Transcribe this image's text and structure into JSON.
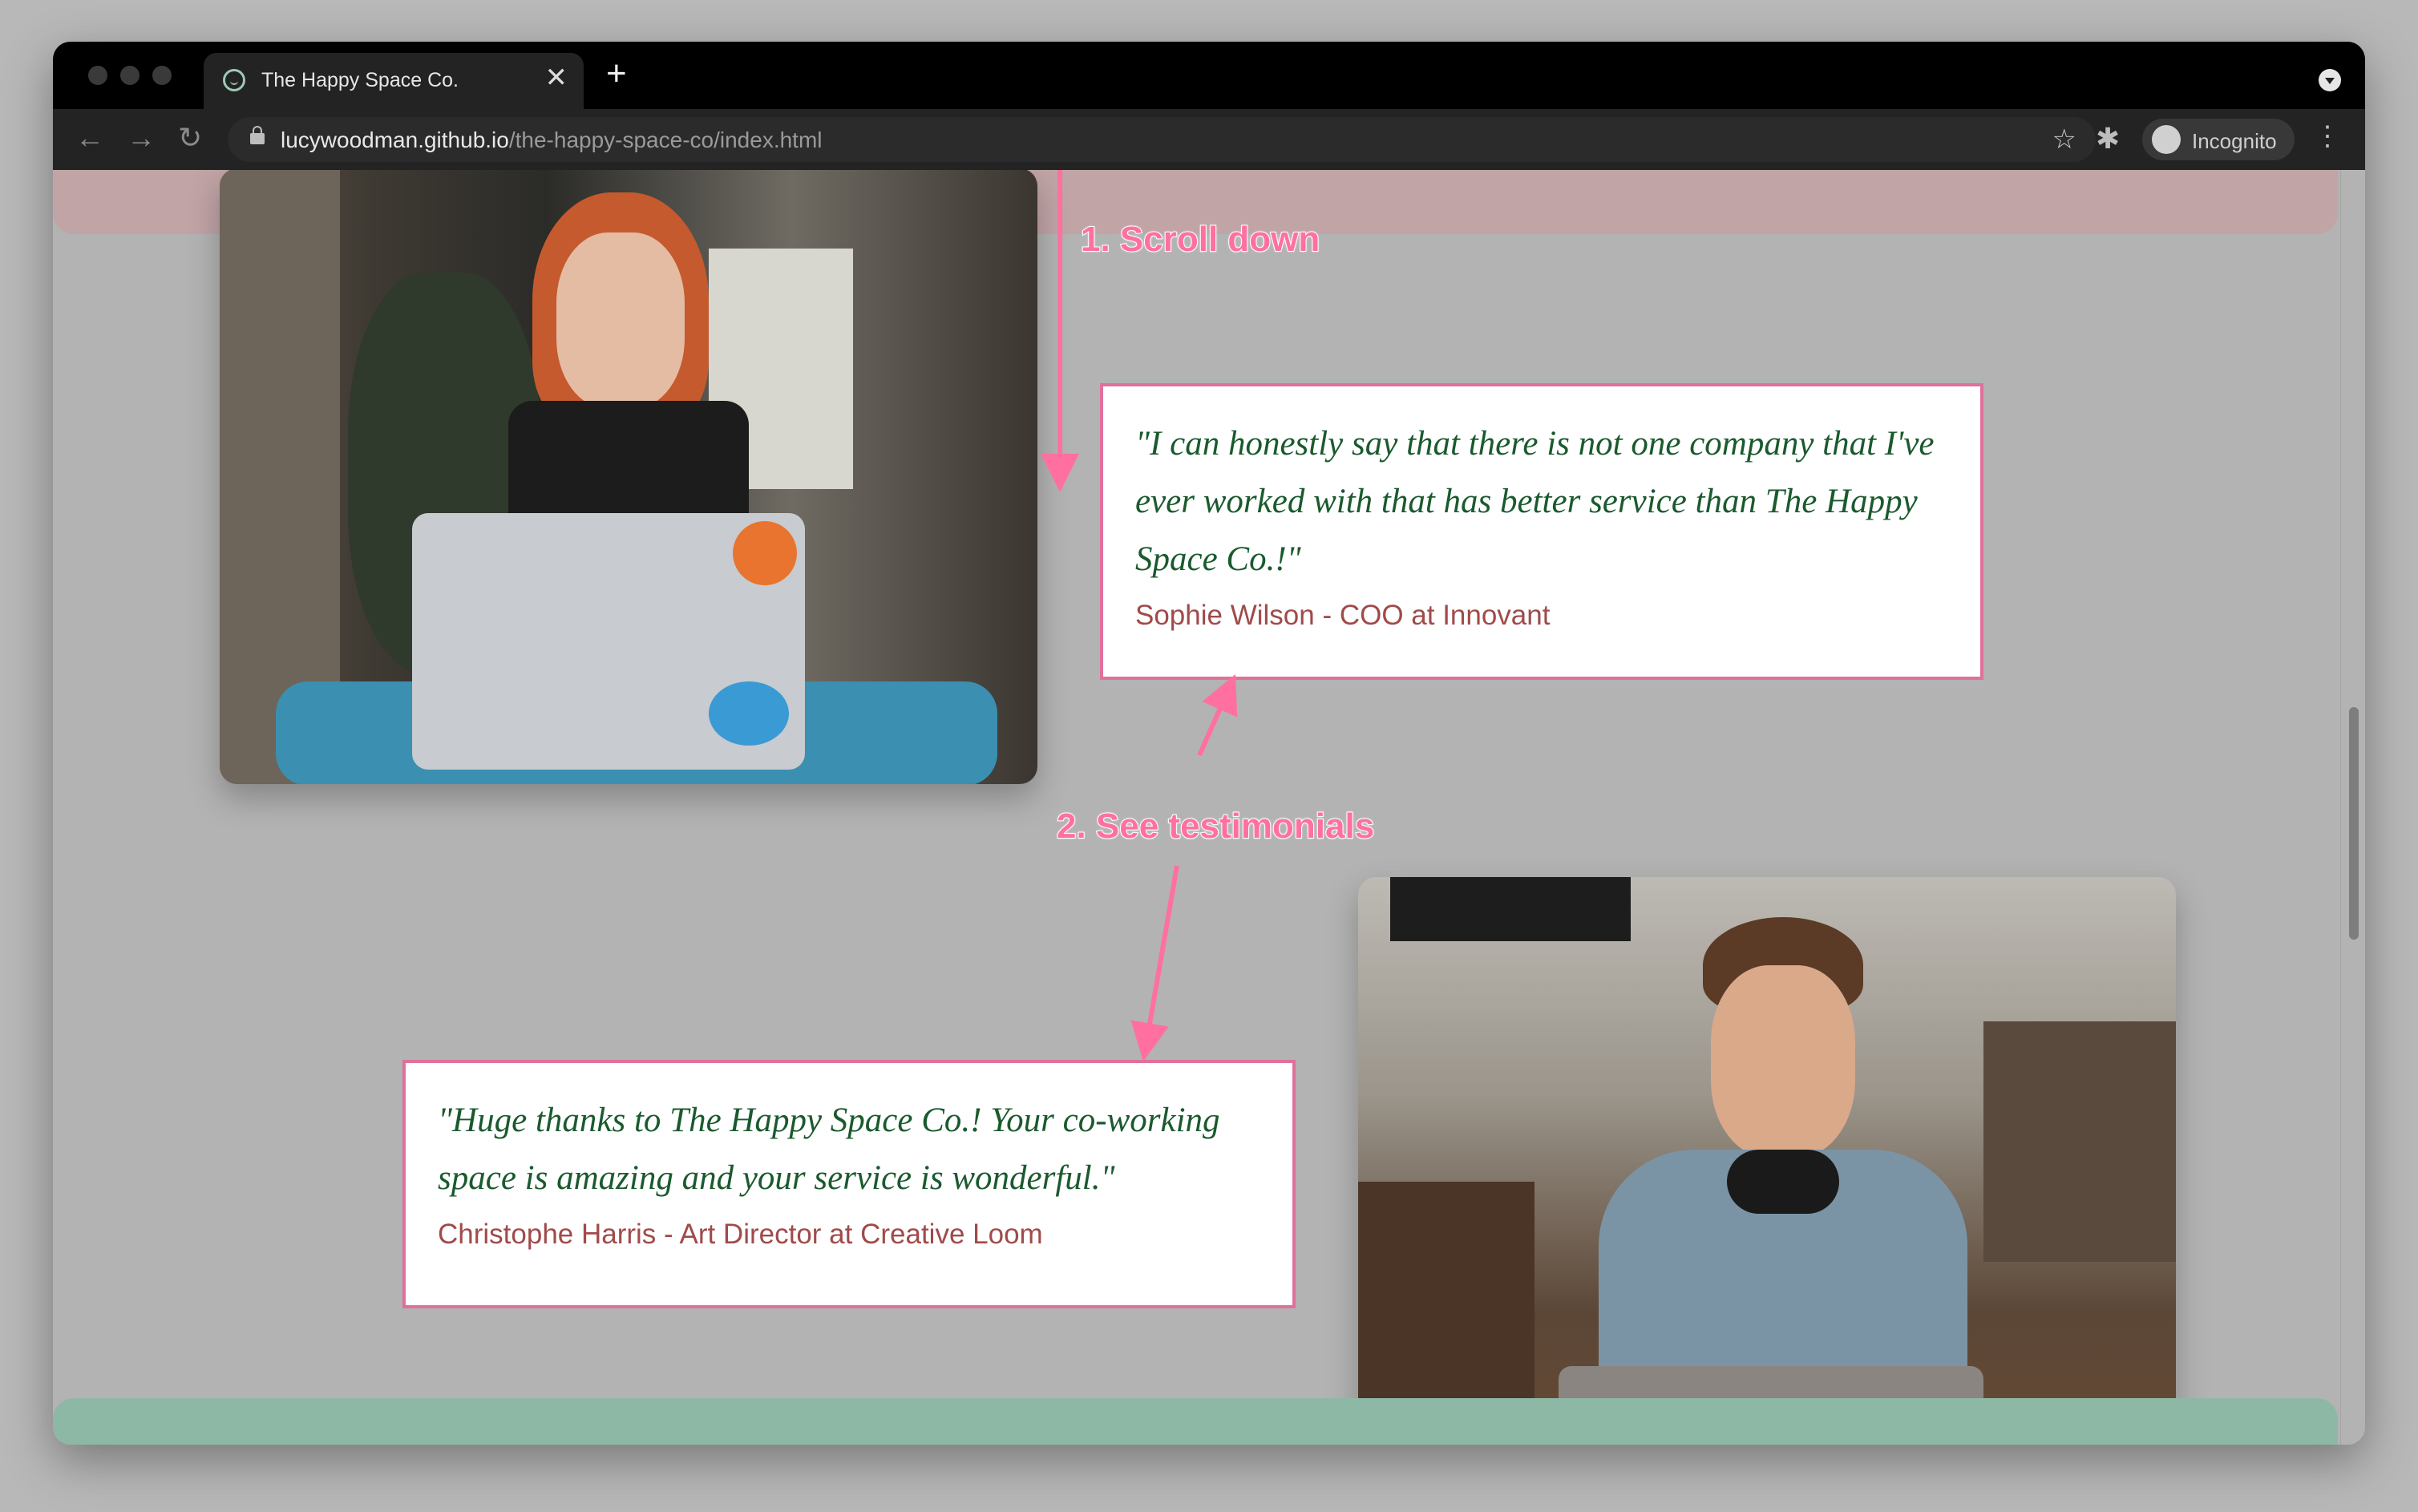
{
  "browser": {
    "tab_title": "The Happy Space Co.",
    "tab_close_glyph": "✕",
    "new_tab_glyph": "+",
    "url_host": "lucywoodman.github.io",
    "url_path": "/the-happy-space-co/index.html",
    "incognito_label": "Incognito",
    "icons": [
      "back-icon",
      "forward-icon",
      "reload-icon",
      "lock-icon",
      "star-icon",
      "extensions-icon",
      "incognito-icon",
      "menu-icon"
    ]
  },
  "page": {
    "testimonials": [
      {
        "quote": "\"I can honestly say that there is not one company that I've ever worked with that has better service than The Happy Space Co.!\"",
        "author": "Sophie Wilson - COO at Innovant"
      },
      {
        "quote": "\"Huge thanks to The Happy Space Co.! Your co-working space is amazing and your service is wonderful.\"",
        "author": "Christophe Harris - Art Director at Creative Loom"
      }
    ]
  },
  "annotations": {
    "step1": "1. Scroll down",
    "step2": "2. See testimonials"
  },
  "colors": {
    "accent_pink": "#e0709c",
    "quote_green": "#1a5a2e",
    "author_red": "#a14a4a",
    "header_pink": "#c0a4a6",
    "footer_green": "#8db8a6"
  }
}
